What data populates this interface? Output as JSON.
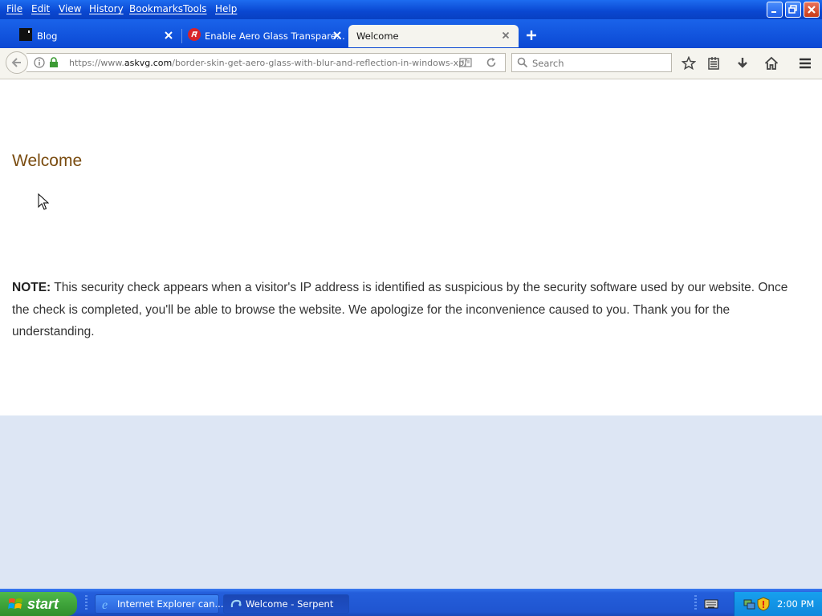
{
  "menu": {
    "items": [
      "File",
      "Edit",
      "View",
      "History",
      "Bookmarks",
      "Tools",
      "Help"
    ]
  },
  "tabs": [
    {
      "label": "Blog",
      "icon": "blog-favicon"
    },
    {
      "label": "Enable Aero Glass Transpare...",
      "icon": "red-r-favicon"
    },
    {
      "label": "Welcome",
      "icon": ""
    }
  ],
  "navbar": {
    "url_prefix": "https://www.",
    "url_host": "askvg.com",
    "url_path": "/border-skin-get-aero-glass-with-blur-and-reflection-in-windows-xp/",
    "search_placeholder": "Search"
  },
  "page": {
    "heading": "Welcome",
    "note_label": "NOTE:",
    "note_text": " This security check appears when a visitor's IP address is identified as suspicious by the security software used by our website. Once the check is completed, you'll be able to browse the website. We apologize for the inconvenience caused to you. Thank you for the understanding."
  },
  "taskbar": {
    "start_label": "start",
    "tasks": [
      {
        "label": "Internet Explorer can...",
        "icon": "ie-icon"
      },
      {
        "label": "Welcome - Serpent",
        "icon": "serpent-icon",
        "active": true
      }
    ],
    "clock": "2:00 PM"
  },
  "colors": {
    "heading": "#7a4c10",
    "frame_blue": "#0a47d1",
    "content_bg": "#dde6f4"
  }
}
